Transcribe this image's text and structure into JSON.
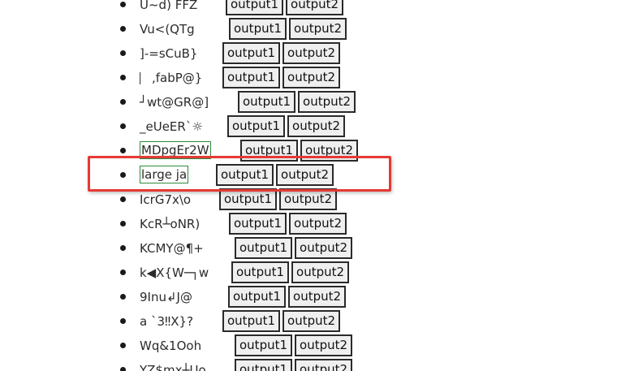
{
  "highlight_color": "#e53935",
  "button_labels": {
    "output1": "output1",
    "output2": "output2"
  },
  "items": [
    {
      "label": "U~d) FFZ"
    },
    {
      "label": "Vu<(QTg"
    },
    {
      "label": "]-=sCuB}"
    },
    {
      "label": "⎸,fabP@}"
    },
    {
      "label": "┘wt@GR@]"
    },
    {
      "label": "_eUeER`☼"
    },
    {
      "label": "MDpgEr2W"
    },
    {
      "label": "large ja"
    },
    {
      "label": "IcrG7x\\o"
    },
    {
      "label": "KcR┴oNR)"
    },
    {
      "label": "KCMY@¶+"
    },
    {
      "label": "k◀X{W─┐w"
    },
    {
      "label": "9Inu↲J@"
    },
    {
      "label": "a `3‼X}?"
    },
    {
      "label": "Wq&1Ooh"
    },
    {
      "label": "YZ$mx┼Uo"
    }
  ]
}
